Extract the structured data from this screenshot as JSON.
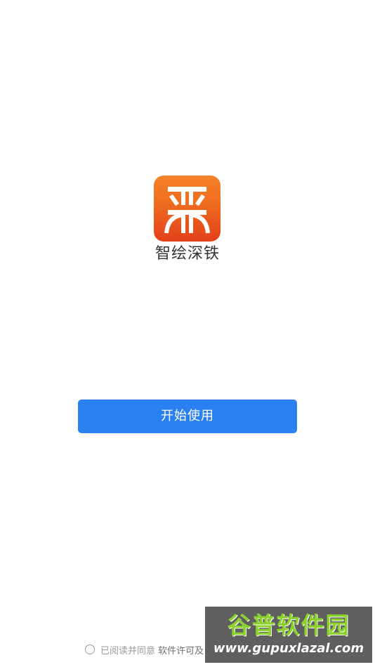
{
  "app": {
    "name": "智绘深铁",
    "logo_icon": "shenzhen-metro-logo-icon",
    "logo_gradient": [
      "#f5832a",
      "#e4401a"
    ]
  },
  "actions": {
    "start_label": "开始使用",
    "start_color": "#2b80f0"
  },
  "agreement": {
    "text": "已阅读并同意",
    "link": "软件许可及"
  },
  "watermark": {
    "title": "谷普软件园",
    "url": "www.gupuxlazal.com"
  }
}
